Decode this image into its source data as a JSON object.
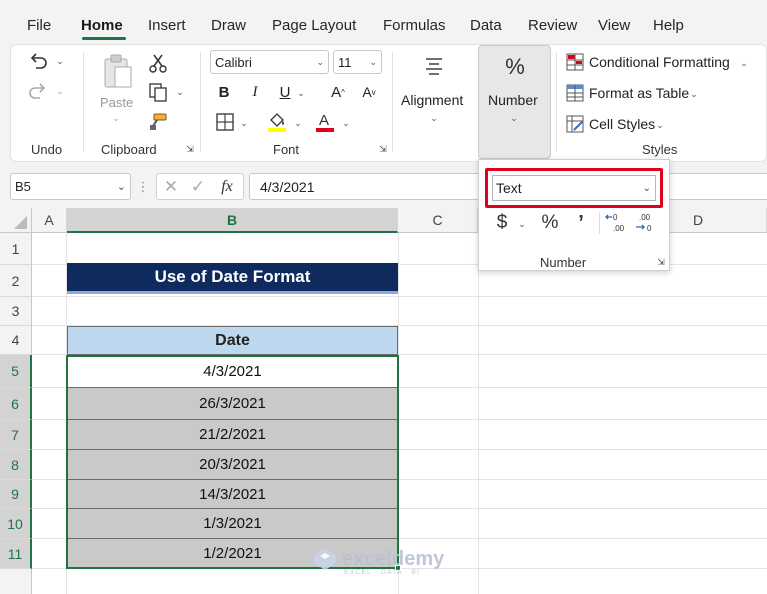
{
  "menu": {
    "tabs": [
      "File",
      "Home",
      "Insert",
      "Draw",
      "Page Layout",
      "Formulas",
      "Data",
      "Review",
      "View",
      "Help"
    ],
    "active": "Home"
  },
  "ribbon": {
    "undo": {
      "label": "Undo"
    },
    "clipboard": {
      "label": "Clipboard",
      "paste": "Paste"
    },
    "font": {
      "label": "Font",
      "name": "Calibri",
      "size": "11"
    },
    "alignment": {
      "label": "Alignment"
    },
    "number": {
      "label": "Number"
    },
    "styles": {
      "label": "Styles",
      "conditional": "Conditional Formatting",
      "table": "Format as Table",
      "cell_styles": "Cell Styles"
    }
  },
  "number_flyout": {
    "format_value": "Text",
    "label": "Number"
  },
  "formula_bar": {
    "name_box": "B5",
    "fx": "fx",
    "content": "4/3/2021"
  },
  "sheet": {
    "columns": [
      "A",
      "B",
      "C",
      "D"
    ],
    "rows": [
      "1",
      "2",
      "3",
      "4",
      "5",
      "6",
      "7",
      "8",
      "9",
      "10",
      "11"
    ],
    "title": "Use of Date Format",
    "header": "Date",
    "dates": [
      "4/3/2021",
      "26/3/2021",
      "21/2/2021",
      "20/3/2021",
      "14/3/2021",
      "1/3/2021",
      "1/2/2021"
    ]
  },
  "watermark": {
    "name": "exceldemy",
    "tagline": "EXCEL · DATA · BI"
  },
  "colors": {
    "accent": "#217346",
    "title_bg": "#0f2a5c",
    "header_bg": "#bdd7ee",
    "highlight": "#e0001b"
  }
}
